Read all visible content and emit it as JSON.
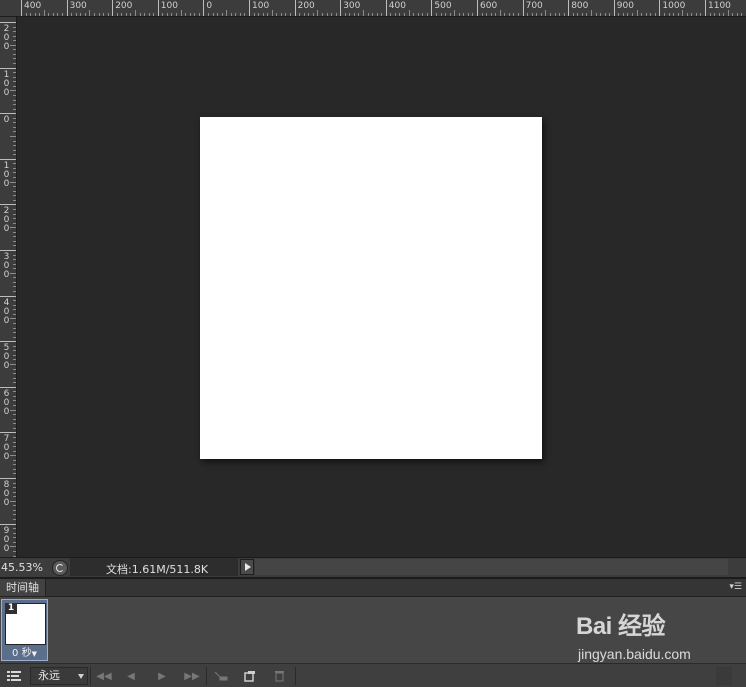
{
  "ruler": {
    "horizontal_labels": [
      "400",
      "300",
      "200",
      "100",
      "0",
      "100",
      "200",
      "300",
      "400",
      "500",
      "600",
      "700",
      "800",
      "900",
      "1000",
      "1100"
    ],
    "vertical_labels": [
      "200",
      "100",
      "0",
      "100",
      "200",
      "300",
      "400",
      "500",
      "600",
      "700",
      "800",
      "900"
    ]
  },
  "status": {
    "zoom": "45.53%",
    "doc_info": "文档:1.61M/511.8K"
  },
  "timeline": {
    "tab_label": "时间轴",
    "menu_icon": "panel-menu-icon",
    "frames": [
      {
        "number": "1",
        "delay": "0 秒"
      }
    ],
    "loop_option": "永远",
    "footer_buttons": [
      "convert-icon",
      "first-frame-icon",
      "prev-frame-icon",
      "play-icon",
      "next-frame-icon",
      "tween-icon",
      "duplicate-frame-icon",
      "trash-icon"
    ]
  },
  "watermark": {
    "logo": "Bai 经验",
    "url": "jingyan.baidu.com"
  },
  "colors": {
    "canvas_bg": "#282828",
    "document": "#ffffff",
    "panel": "#464646",
    "frame_selected": "#5b6e8b"
  }
}
